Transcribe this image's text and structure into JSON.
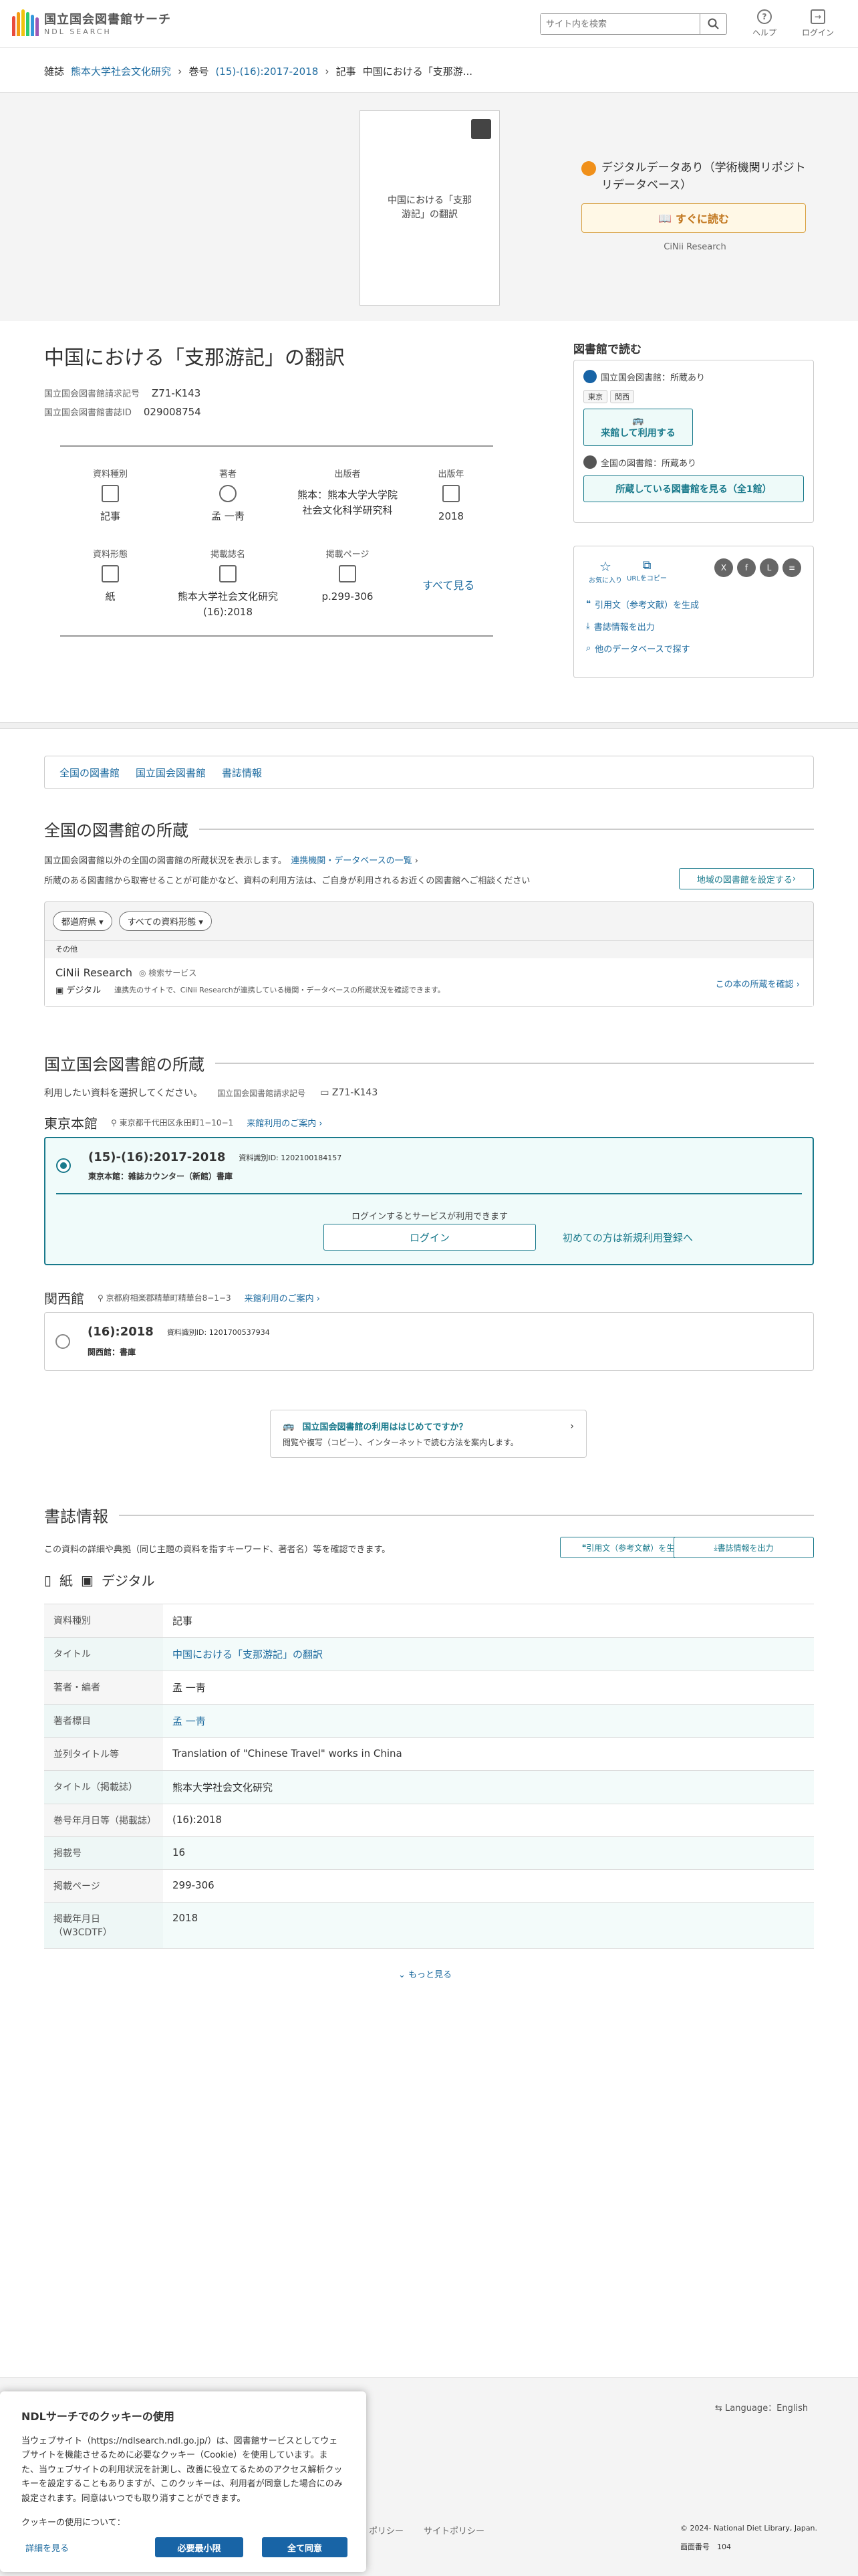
{
  "header": {
    "logo_title": "国立国会図書館サーチ",
    "logo_sub": "NDL SEARCH",
    "search_placeholder": "サイト内を検索",
    "help": "ヘルプ",
    "login": "ログイン"
  },
  "breadcrumb": {
    "l1": "雑誌",
    "l1_link": "熊本大学社会文化研究",
    "l2": "巻号",
    "l2_link": "(15)-(16):2017-2018",
    "l3": "記事",
    "l3_text": "中国における「支那游..."
  },
  "cover": {
    "text": "中国における「支那游記」の翻訳"
  },
  "digital": {
    "label": "デジタルデータあり（学術機関リポジトリデータベース）",
    "read_button": "すぐに読む",
    "source": "CiNii Research"
  },
  "title": "中国における「支那游記」の翻訳",
  "meta": {
    "call_label": "国立国会図書館請求記号",
    "call_value": "Z71-K143",
    "id_label": "国立国会図書館書誌ID",
    "id_value": "029008754"
  },
  "grid": {
    "type_label": "資料種別",
    "type_value": "記事",
    "author_label": "著者",
    "author_value": "孟 一靑",
    "publisher_label": "出版者",
    "publisher_value": "熊本：熊本大学大学院社会文化科学研究科",
    "year_label": "出版年",
    "year_value": "2018",
    "form_label": "資料形態",
    "form_value": "紙",
    "journal_label": "掲載誌名",
    "journal_value": "熊本大学社会文化研究 (16):2018",
    "page_label": "掲載ページ",
    "page_value": "p.299-306",
    "see_all": "すべて見る"
  },
  "side": {
    "heading": "図書館で読む",
    "ndl_status": "国立国会図書館：所蔵あり",
    "tag_tokyo": "東京",
    "tag_kansai": "関西",
    "visit_button": "来館して利用する",
    "national_status": "全国の図書館：所蔵あり",
    "holdings_button": "所蔵している図書館を見る（全1館）",
    "favorite": "お気に入り",
    "copy_url": "URLをコピー",
    "link_cite": "引用文（参考文献）を生成",
    "link_export": "書誌情報を出力",
    "link_other": "他のデータベースで探す"
  },
  "tabs": [
    "全国の図書館",
    "国立国会図書館",
    "書誌情報"
  ],
  "national": {
    "heading": "全国の図書館の所蔵",
    "desc1": "国立国会図書館以外の全国の図書館の所蔵状況を表示します。",
    "desc1_link": "連携機関・データベースの一覧",
    "desc2": "所蔵のある図書館から取寄せることが可能かなど、資料の利用方法は、ご自身が利用されるお近くの図書館へご相談ください",
    "region_button": "地域の図書館を設定する",
    "filter_pref": "都道府県",
    "filter_type": "すべての資料形態",
    "group": "その他",
    "lib_name": "CiNii Research",
    "lib_service": "検索サービス",
    "lib_tag": "デジタル",
    "lib_desc": "連携先のサイトで、CiNii Researchが連携している機関・データベースの所蔵状況を確認できます。",
    "lib_link": "この本の所蔵を確認"
  },
  "ndl": {
    "heading": "国立国会図書館の所蔵",
    "select_text": "利用したい資料を選択してください。",
    "call_label": "国立国会図書館請求記号",
    "call_value": "Z71-K143",
    "tokyo_name": "東京本館",
    "tokyo_addr": "東京都千代田区永田町1−10−1",
    "tokyo_guide": "来館利用のご案内",
    "tokyo_item": "(15)-(16):2017-2018",
    "tokyo_item_id": "資料識別ID: 1202100184157",
    "tokyo_loc": "東京本館：雑誌カウンター（新館）書庫",
    "login_hint": "ログインするとサービスが利用できます",
    "login_button": "ログイン",
    "register_link": "初めての方は新規利用登録へ",
    "kansai_name": "関西館",
    "kansai_addr": "京都府相楽郡精華町精華台8−1−3",
    "kansai_guide": "来館利用のご案内",
    "kansai_item": "(16):2018",
    "kansai_item_id": "資料識別ID: 1201700537934",
    "kansai_loc": "関西館：書庫",
    "first_time_title": "国立国会図書館の利用ははじめてですか？",
    "first_time_desc": "閲覧や複写（コピー）、インターネットで読む方法を案内します。"
  },
  "biblio": {
    "heading": "書誌情報",
    "desc": "この資料の詳細や典拠（同じ主題の資料を指すキーワード、著者名）等を確認できます。",
    "cite_button": "引用文（参考文献）を生成",
    "export_button": "書誌情報を出力",
    "form_paper": "紙",
    "form_digital": "デジタル",
    "rows": [
      {
        "k": "資料種別",
        "v": "記事"
      },
      {
        "k": "タイトル",
        "v": "中国における「支那游記」の翻訳"
      },
      {
        "k": "著者・編者",
        "v": "孟 一靑"
      },
      {
        "k": "著者標目",
        "v": "孟 一靑"
      },
      {
        "k": "並列タイトル等",
        "v": "Translation of \"Chinese Travel\" works in China"
      },
      {
        "k": "タイトル（掲載誌）",
        "v": "熊本大学社会文化研究"
      },
      {
        "k": "巻号年月日等（掲載誌）",
        "v": "(16):2018"
      },
      {
        "k": "掲載号",
        "v": "16"
      },
      {
        "k": "掲載ページ",
        "v": "299-306"
      },
      {
        "k": "掲載年月日（W3CDTF）",
        "v": "2018"
      }
    ],
    "more": "もっと見る"
  },
  "footer": {
    "language": "Language：English",
    "policy1": "ポリシー",
    "policy2": "サイトポリシー",
    "copyright": "© 2024- National Diet Library, Japan.",
    "server_label": "画面番号",
    "server_value": "104"
  },
  "cookie": {
    "title": "NDLサーチでのクッキーの使用",
    "body": "当ウェブサイト（https://ndlsearch.ndl.go.jp/）は、図書館サービスとしてウェブサイトを機能させるために必要なクッキー（Cookie）を使用しています。また、当ウェブサイトの利用状況を計測し、改善に役立てるためのアクセス解析クッキーを設定することもありますが、このクッキーは、利用者が同意した場合にのみ設定されます。同意はいつでも取り消すことができます。",
    "usage": "クッキーの使用について：",
    "details": "詳細を見る",
    "min_button": "必要最小限",
    "all_button": "全て同意"
  },
  "colors": {
    "teal": "#1a7a8c",
    "link": "#1f6ca0",
    "accent_orange": "#f0901a",
    "button_blue": "#1864a6"
  }
}
